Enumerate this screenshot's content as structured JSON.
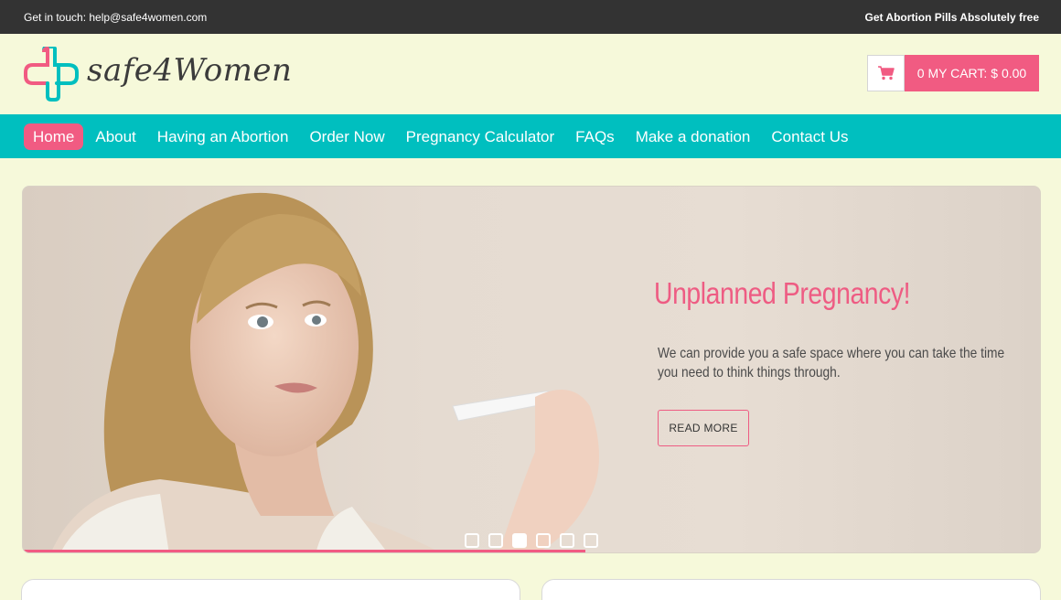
{
  "topbar": {
    "contact": "Get in touch: help@safe4women.com",
    "promo": "Get Abortion Pills Absolutely free"
  },
  "header": {
    "brand": "safe4Women",
    "cart_label": "0 MY CART:",
    "cart_total": "$ 0.00"
  },
  "nav": {
    "items": [
      {
        "label": "Home",
        "active": true
      },
      {
        "label": "About"
      },
      {
        "label": "Having an Abortion"
      },
      {
        "label": "Order Now"
      },
      {
        "label": "Pregnancy Calculator"
      },
      {
        "label": "FAQs"
      },
      {
        "label": "Make a donation"
      },
      {
        "label": "Contact Us"
      }
    ]
  },
  "slider": {
    "title": "Unplanned Pregnancy!",
    "text": "We can provide you a safe space where you can take the time you need to think things through.",
    "button": "READ MORE",
    "slide_count": 6,
    "active_slide": 3
  },
  "colors": {
    "accent_pink": "#f15b82",
    "teal": "#00bfbf",
    "topbar": "#333333",
    "background": "#f6f9da"
  },
  "icons": {
    "logo": "cross-logo-icon",
    "cart": "shopping-cart-icon"
  }
}
